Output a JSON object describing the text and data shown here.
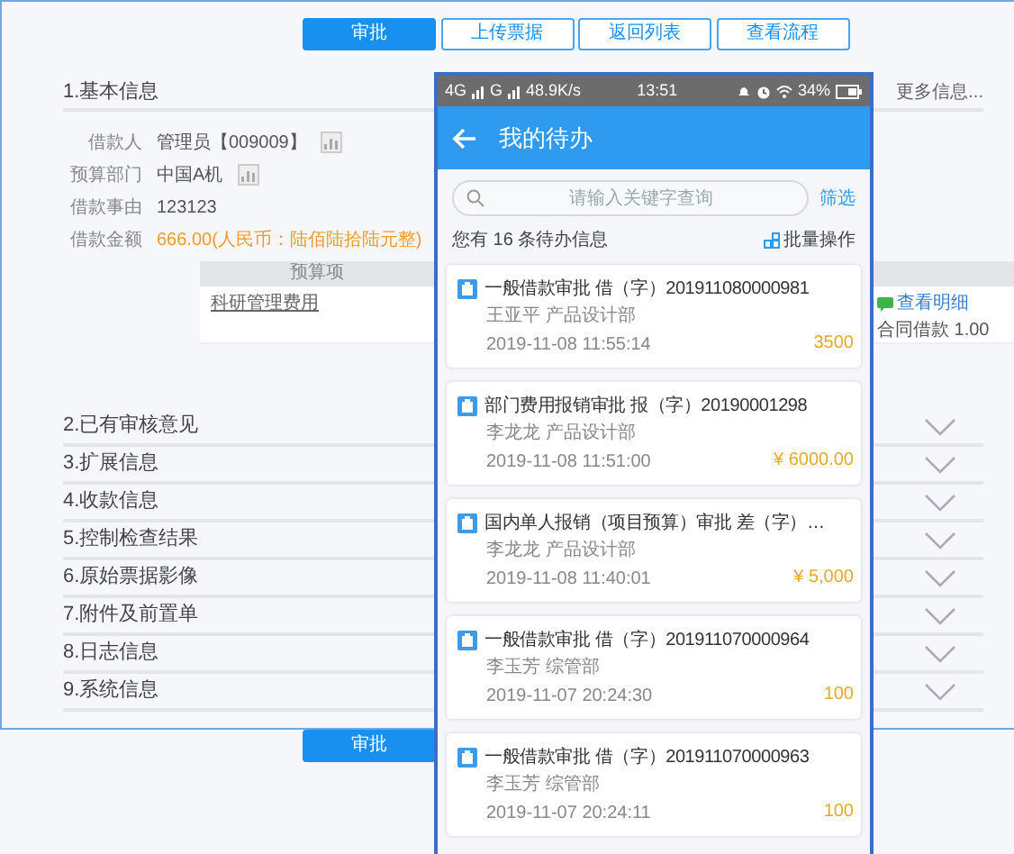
{
  "toolbar": {
    "buttons": [
      {
        "label": "审批",
        "primary": true
      },
      {
        "label": "上传票据",
        "primary": false
      },
      {
        "label": "返回列表",
        "primary": false
      },
      {
        "label": "查看流程",
        "primary": false
      }
    ]
  },
  "sections": [
    {
      "title": "1.基本信息",
      "expanded": true,
      "more_link": "更多信息...",
      "fields": [
        {
          "label": "借款人",
          "value": "管理员【009009】",
          "has_icon": true,
          "emphasis": false
        },
        {
          "label": "预算部门",
          "value": "中国A机",
          "has_icon": true,
          "emphasis": false
        },
        {
          "label": "借款事由",
          "value": "123123",
          "has_icon": false,
          "emphasis": false
        },
        {
          "label": "借款金额",
          "value": "666.00(人民币：陆佰陆拾陆元整)",
          "has_icon": false,
          "emphasis": true
        }
      ],
      "table": {
        "columns": [
          "预算项"
        ],
        "rows": [
          {
            "item": "科研管理费用",
            "detail_link": "查看明细",
            "note": "合同借款 1.00"
          }
        ]
      }
    },
    {
      "title": "2.已有审核意见",
      "expanded": false
    },
    {
      "title": "3.扩展信息",
      "expanded": false
    },
    {
      "title": "4.收款信息",
      "expanded": false
    },
    {
      "title": "5.控制检查结果",
      "expanded": false
    },
    {
      "title": "6.原始票据影像",
      "expanded": false
    },
    {
      "title": "7.附件及前置单",
      "expanded": false
    },
    {
      "title": "8.日志信息",
      "expanded": false
    },
    {
      "title": "9.系统信息",
      "expanded": false
    }
  ],
  "bottom_button": "审批",
  "phone": {
    "status_bar": {
      "network_1": "4G",
      "network_2": "G",
      "speed": "48.9K/s",
      "time": "13:51",
      "battery": "34%"
    },
    "title": "我的待办",
    "search": {
      "placeholder": "请输入关键字查询"
    },
    "filter": "筛选",
    "count_text": "您有 16 条待办信息",
    "batch": "批量操作",
    "items": [
      {
        "title": "一般借款审批 借（字）201911080000981",
        "person": "王亚平 产品设计部",
        "time": "2019-11-08 11:55:14",
        "amount": "3500"
      },
      {
        "title": "部门费用报销审批 报（字）20190001298",
        "person": "李龙龙 产品设计部",
        "time": "2019-11-08 11:51:00",
        "amount": "¥ 6000.00"
      },
      {
        "title": "国内单人报销（项目预算）审批 差（字）…",
        "person": "李龙龙 产品设计部",
        "time": "2019-11-08 11:40:01",
        "amount": "¥ 5,000"
      },
      {
        "title": "一般借款审批 借（字）201911070000964",
        "person": "李玉芳 综管部",
        "time": "2019-11-07 20:24:30",
        "amount": "100"
      },
      {
        "title": "一般借款审批 借（字）201911070000963",
        "person": "李玉芳 综管部",
        "time": "2019-11-07 20:24:11",
        "amount": "100"
      }
    ]
  }
}
